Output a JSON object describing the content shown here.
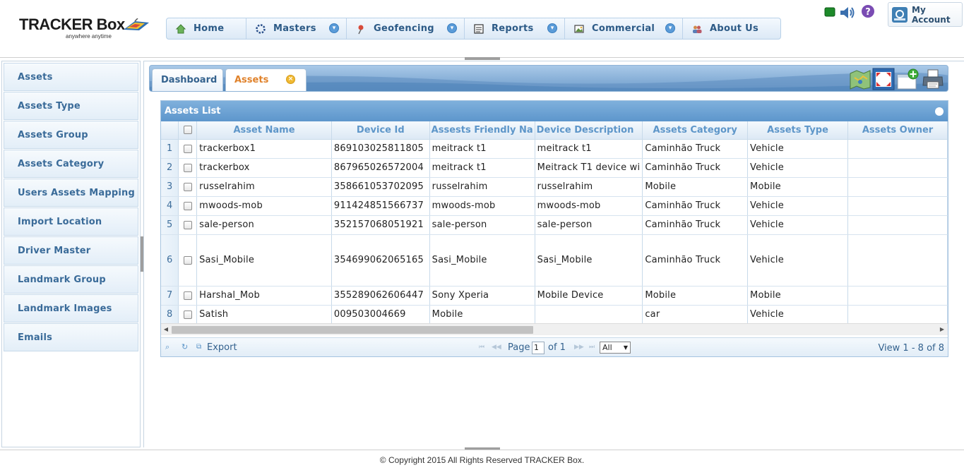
{
  "brand": {
    "logo_text": "TRACKER Box",
    "logo_tagline": "anywhere anytime"
  },
  "topnav": {
    "items": [
      {
        "label": "Home",
        "icon": "home-icon",
        "dropdown": false
      },
      {
        "label": "Masters",
        "icon": "gear-ring-icon",
        "dropdown": true
      },
      {
        "label": "Geofencing",
        "icon": "map-pin-icon",
        "dropdown": true
      },
      {
        "label": "Reports",
        "icon": "report-icon",
        "dropdown": true
      },
      {
        "label": "Commercial",
        "icon": "picture-icon",
        "dropdown": true
      },
      {
        "label": "About Us",
        "icon": "users-icon",
        "dropdown": false
      }
    ]
  },
  "account": {
    "label": "My Account"
  },
  "sidebar": {
    "items": [
      {
        "label": "Assets"
      },
      {
        "label": "Assets Type"
      },
      {
        "label": "Assets Group"
      },
      {
        "label": "Assets Category"
      },
      {
        "label": "Users Assets Mapping"
      },
      {
        "label": "Import Location"
      },
      {
        "label": "Driver Master"
      },
      {
        "label": "Landmark Group"
      },
      {
        "label": "Landmark Images"
      },
      {
        "label": "Emails"
      }
    ]
  },
  "tabs": {
    "dashboard": "Dashboard",
    "assets": "Assets",
    "close_glyph": "×"
  },
  "grid": {
    "title": "Assets List",
    "collapse_glyph": "−",
    "columns": [
      "Asset Name",
      "Device Id",
      "Assests Friendly Na",
      "Device Description",
      "Assets Category",
      "Assets Type",
      "Assets Owner"
    ],
    "rows": [
      {
        "n": "1",
        "name": "trackerbox1",
        "device_id": "869103025811805",
        "friendly": "meitrack t1",
        "desc": "meitrack t1",
        "category": "Caminhão Truck",
        "type": "Vehicle",
        "owner": ""
      },
      {
        "n": "2",
        "name": "trackerbox",
        "device_id": "867965026572004",
        "friendly": "meitrack t1",
        "desc": "Meitrack T1 device wi",
        "category": "Caminhão Truck",
        "type": "Vehicle",
        "owner": ""
      },
      {
        "n": "3",
        "name": "russelrahim",
        "device_id": "358661053702095",
        "friendly": "russelrahim",
        "desc": "russelrahim",
        "category": "Mobile",
        "type": "Mobile",
        "owner": ""
      },
      {
        "n": "4",
        "name": "mwoods-mob",
        "device_id": "911424851566737",
        "friendly": "mwoods-mob",
        "desc": "mwoods-mob",
        "category": "Caminhão Truck",
        "type": "Vehicle",
        "owner": ""
      },
      {
        "n": "5",
        "name": "sale-person",
        "device_id": "352157068051921",
        "friendly": "sale-person",
        "desc": "sale-person",
        "category": "Caminhão Truck",
        "type": "Vehicle",
        "owner": ""
      },
      {
        "n": "6",
        "name": "Sasi_Mobile",
        "device_id": "354699062065165",
        "friendly": "Sasi_Mobile",
        "desc": "Sasi_Mobile",
        "category": "Caminhão Truck",
        "type": "Vehicle",
        "owner": "",
        "tall": true
      },
      {
        "n": "7",
        "name": "Harshal_Mob",
        "device_id": "355289062606447",
        "friendly": "Sony Xperia",
        "desc": "Mobile Device",
        "category": "Mobile",
        "type": "Mobile",
        "owner": ""
      },
      {
        "n": "8",
        "name": "Satish",
        "device_id": "009503004669",
        "friendly": "Mobile",
        "desc": "",
        "category": "car",
        "type": "Vehicle",
        "owner": ""
      }
    ]
  },
  "pager": {
    "export_label": "Export",
    "page_label": "Page",
    "page_value": "1",
    "of_label": "of 1",
    "rows_option": "All",
    "view_text": "View 1 - 8 of 8"
  },
  "footer": {
    "copyright": "© Copyright 2015 All Rights Reserved TRACKER Box."
  }
}
